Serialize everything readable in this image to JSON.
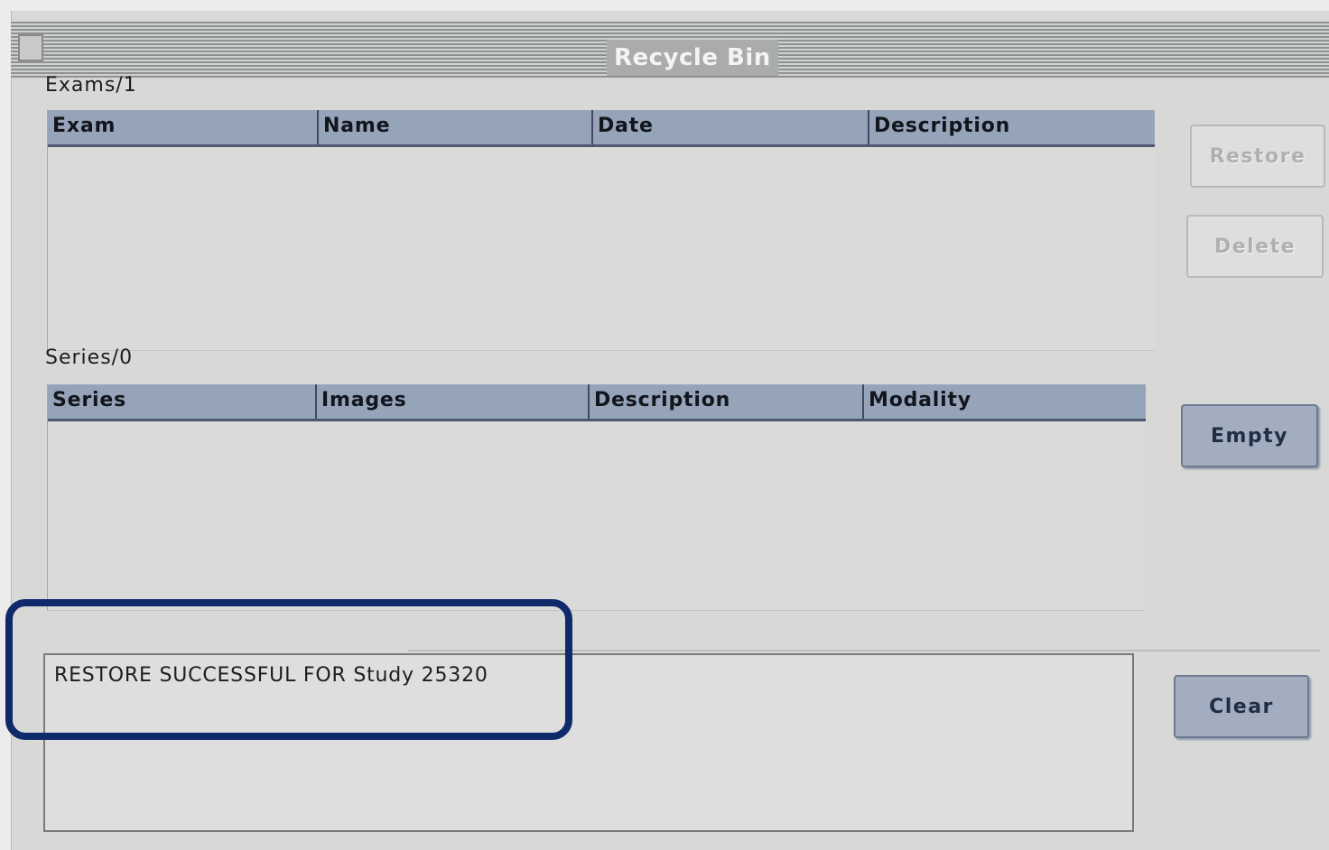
{
  "window": {
    "title": "Recycle Bin"
  },
  "exams": {
    "label": "Exams/1",
    "columns": [
      "Exam",
      "Name",
      "Date",
      "Description"
    ]
  },
  "series": {
    "label": "Series/0",
    "columns": [
      "Series",
      "Images",
      "Description",
      "Modality"
    ]
  },
  "buttons": {
    "restore": "Restore",
    "delete": "Delete",
    "empty": "Empty",
    "clear": "Clear"
  },
  "messages": {
    "line1": "RESTORE SUCCESSFUL FOR Study 25320"
  },
  "colors": {
    "header_fill": "#96a4ba",
    "highlight_border": "#0f2a6b"
  }
}
